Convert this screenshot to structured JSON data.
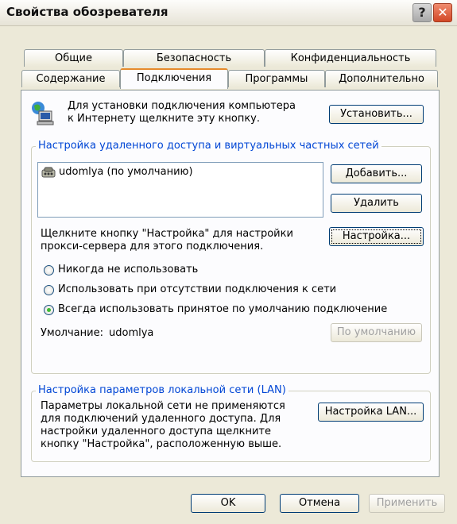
{
  "window": {
    "title": "Свойства обозревателя",
    "help_label": "?",
    "close_label": "✕"
  },
  "tabs_row1": [
    "Общие",
    "Безопасность",
    "Конфиденциальность"
  ],
  "tabs_row2": [
    "Содержание",
    "Подключения",
    "Программы",
    "Дополнительно"
  ],
  "selected_tab": "Подключения",
  "setup": {
    "text_line1": "Для установки подключения компьютера",
    "text_line2": "к Интернету щелкните эту кнопку.",
    "button": "Установить..."
  },
  "dialup_group": {
    "title": "Настройка удаленного доступа и виртуальных частных сетей",
    "connections": [
      {
        "label": "udomlya (по умолчанию)"
      }
    ],
    "add_button": "Добавить...",
    "remove_button": "Удалить",
    "settings_text_line1": "Щелкните кнопку \"Настройка\" для настройки",
    "settings_text_line2": "прокси-сервера для этого подключения.",
    "settings_button": "Настройка...",
    "options": [
      {
        "label": "Никогда не использовать",
        "selected": false
      },
      {
        "label": "Использовать при отсутствии подключения к сети",
        "selected": false
      },
      {
        "label": "Всегда использовать принятое по умолчанию подключение",
        "selected": true
      }
    ],
    "default_label": "Умолчание:",
    "default_value": "udomlya",
    "default_button": "По умолчанию"
  },
  "lan_group": {
    "title": "Настройка параметров локальной сети (LAN)",
    "text_lines": [
      "Параметры локальной сети не применяются",
      "для подключений удаленного доступа. Для",
      "настройки удаленного доступа щелкните",
      "кнопку \"Настройка\", расположенную выше."
    ],
    "button": "Настройка LAN..."
  },
  "footer": {
    "ok": "OK",
    "cancel": "Отмена",
    "apply": "Применить"
  },
  "icons": {
    "setup": "internet-connection-icon",
    "connection": "dialup-connection-icon"
  }
}
